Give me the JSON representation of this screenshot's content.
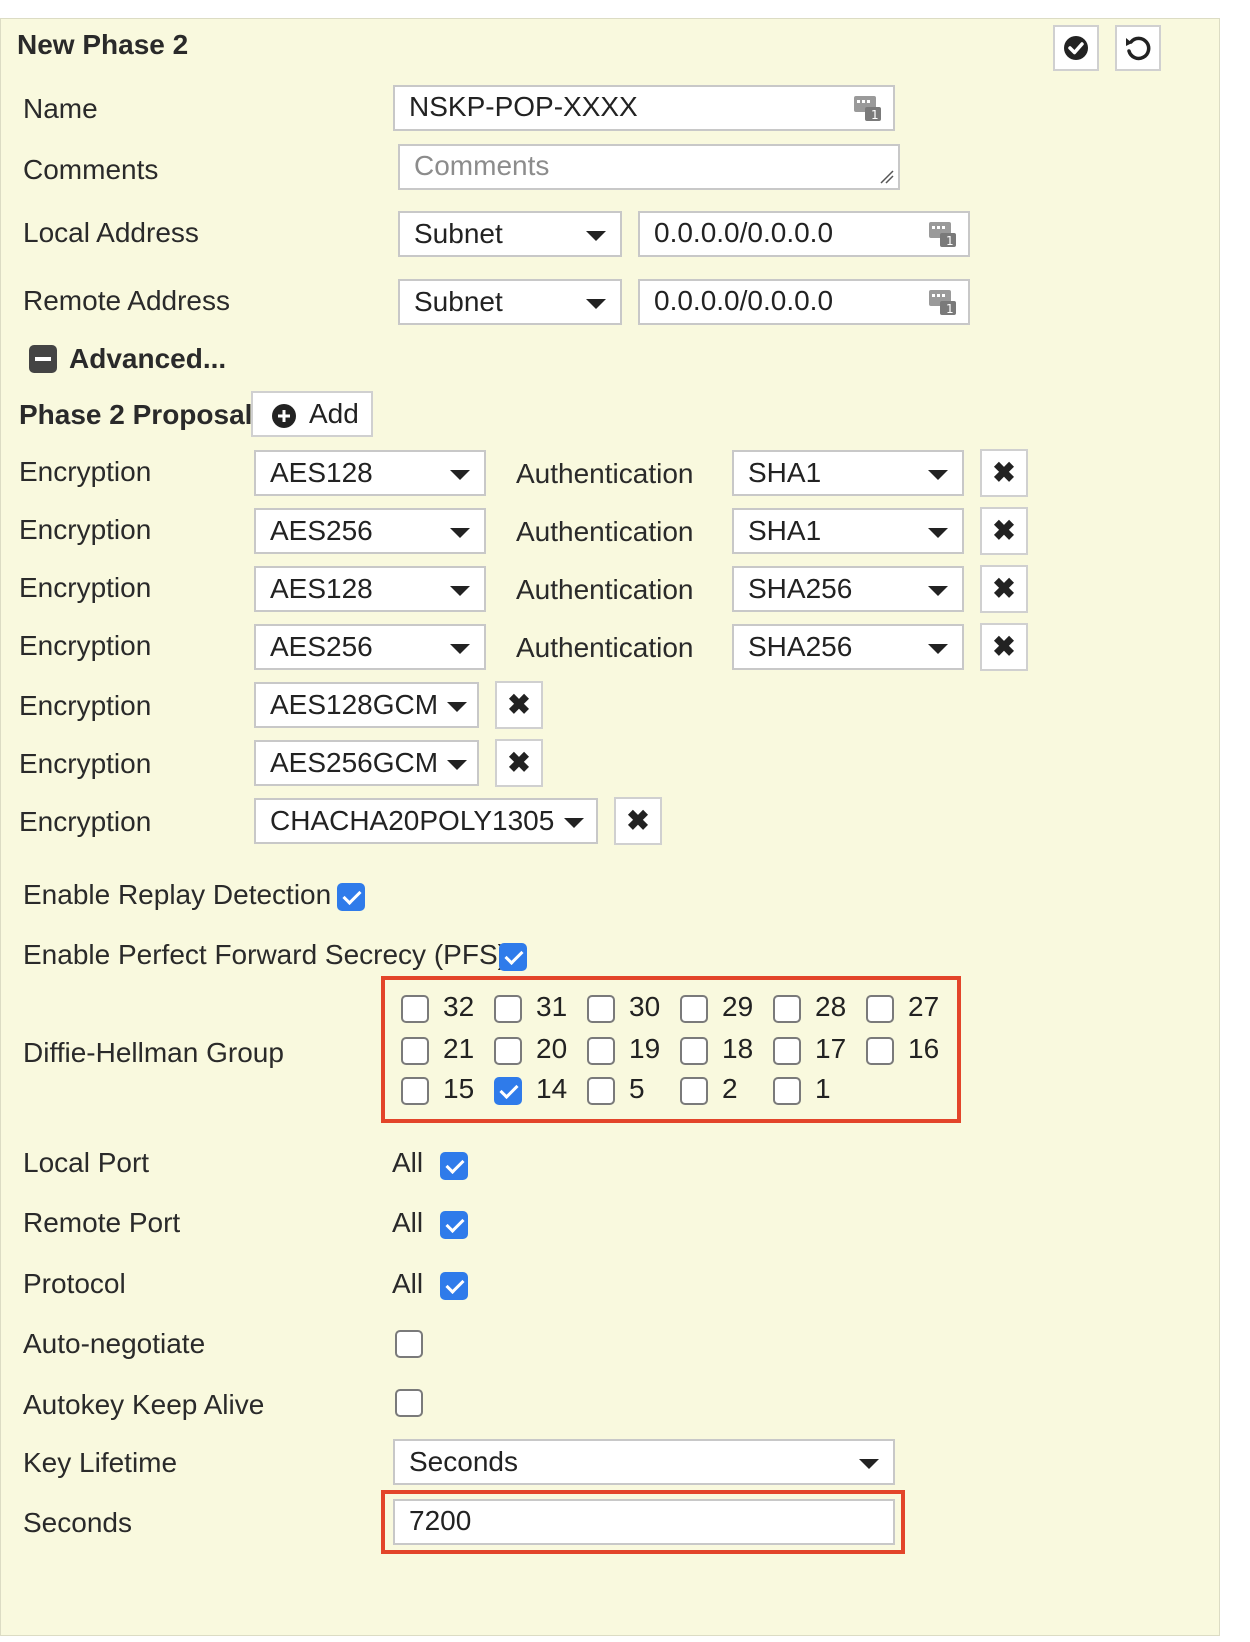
{
  "header": {
    "title": "New Phase 2"
  },
  "name": {
    "label": "Name",
    "value": "NSKP-POP-XXXX"
  },
  "comments": {
    "label": "Comments",
    "placeholder": "Comments"
  },
  "local_address": {
    "label": "Local Address",
    "type": "Subnet",
    "value": "0.0.0.0/0.0.0.0"
  },
  "remote_address": {
    "label": "Remote Address",
    "type": "Subnet",
    "value": "0.0.0.0/0.0.0.0"
  },
  "advanced": {
    "label": "Advanced..."
  },
  "proposal": {
    "label": "Phase 2 Proposal",
    "add_label": "Add",
    "encryption_label": "Encryption",
    "authentication_label": "Authentication",
    "rows": [
      {
        "encryption": "AES128",
        "authentication": "SHA1"
      },
      {
        "encryption": "AES256",
        "authentication": "SHA1"
      },
      {
        "encryption": "AES128",
        "authentication": "SHA256"
      },
      {
        "encryption": "AES256",
        "authentication": "SHA256"
      },
      {
        "encryption": "AES128GCM"
      },
      {
        "encryption": "AES256GCM"
      },
      {
        "encryption": "CHACHA20POLY1305"
      }
    ]
  },
  "replay": {
    "label": "Enable Replay Detection",
    "checked": true
  },
  "pfs": {
    "label": "Enable Perfect Forward Secrecy (PFS)",
    "checked": true
  },
  "dh": {
    "label": "Diffie-Hellman Group",
    "groups": [
      {
        "num": "32",
        "checked": false
      },
      {
        "num": "31",
        "checked": false
      },
      {
        "num": "30",
        "checked": false
      },
      {
        "num": "29",
        "checked": false
      },
      {
        "num": "28",
        "checked": false
      },
      {
        "num": "27",
        "checked": false
      },
      {
        "num": "21",
        "checked": false
      },
      {
        "num": "20",
        "checked": false
      },
      {
        "num": "19",
        "checked": false
      },
      {
        "num": "18",
        "checked": false
      },
      {
        "num": "17",
        "checked": false
      },
      {
        "num": "16",
        "checked": false
      },
      {
        "num": "15",
        "checked": false
      },
      {
        "num": "14",
        "checked": true
      },
      {
        "num": "5",
        "checked": false
      },
      {
        "num": "2",
        "checked": false
      },
      {
        "num": "1",
        "checked": false
      }
    ]
  },
  "local_port": {
    "label": "Local Port",
    "all_label": "All",
    "checked": true
  },
  "remote_port": {
    "label": "Remote Port",
    "all_label": "All",
    "checked": true
  },
  "protocol": {
    "label": "Protocol",
    "all_label": "All",
    "checked": true
  },
  "auto_negotiate": {
    "label": "Auto-negotiate",
    "checked": false
  },
  "keep_alive": {
    "label": "Autokey Keep Alive",
    "checked": false
  },
  "key_lifetime": {
    "label": "Key Lifetime",
    "value": "Seconds"
  },
  "seconds": {
    "label": "Seconds",
    "value": "7200"
  },
  "colors": {
    "accent": "#2f7bea",
    "highlight": "#e3452a",
    "panel": "#f9f9de"
  }
}
